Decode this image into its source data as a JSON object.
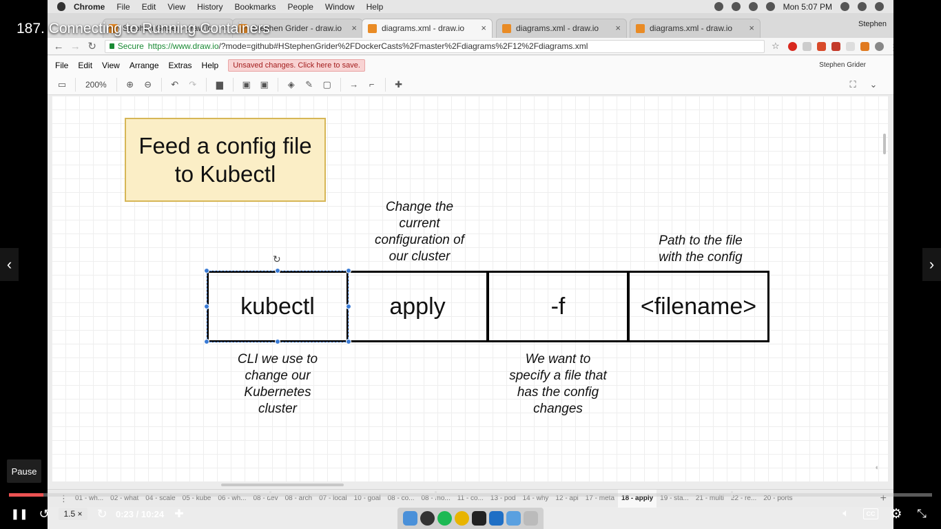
{
  "player": {
    "course_title": "187. Connecting to Running Containers",
    "tooltip": "Pause",
    "speed": "1.5 ×",
    "time": "0:23 / 10:24",
    "progress_fraction": 0.037,
    "accent": "#ec5252"
  },
  "mac_menu": {
    "items": [
      "Chrome",
      "File",
      "Edit",
      "View",
      "History",
      "Bookmarks",
      "People",
      "Window",
      "Help"
    ],
    "clock": "Mon 5:07 PM"
  },
  "browser": {
    "tabs": [
      {
        "title": "Stephen Grider - draw.io",
        "active": false
      },
      {
        "title": "diagrams.xml - draw.io",
        "active": true
      },
      {
        "title": "diagrams.xml - draw.io",
        "active": false
      },
      {
        "title": "diagrams.xml - draw.io",
        "active": false
      }
    ],
    "profile": "Stephen",
    "secure_label": "Secure",
    "url_host": "https://www.draw.io",
    "url_rest": "/?mode=github#HStephenGrider%2FDockerCasts%2Fmaster%2Fdiagrams%2F12%2Fdiagrams.xml"
  },
  "drawio": {
    "menu": [
      "File",
      "Edit",
      "View",
      "Arrange",
      "Extras",
      "Help"
    ],
    "unsaved": "Unsaved changes. Click here to save.",
    "user": "Stephen Grider",
    "zoom": "200%",
    "page_tabs": [
      "01 - wh...",
      "02 - what",
      "04 - scale",
      "05 - kube",
      "06 - wh...",
      "08 - dev",
      "08 - arch",
      "07 - local",
      "10 - goal",
      "08 - co...",
      "08 - mo...",
      "11 - co...",
      "13 - pod",
      "14 - why",
      "12 - api",
      "17 - meta",
      "18 - apply",
      "19 - sta...",
      "21 - multi",
      "22 - re...",
      "20 - ports"
    ],
    "active_page": "18 - apply"
  },
  "diagram": {
    "title": "Feed a config file\nto Kubectl",
    "cells": [
      "kubectl",
      "apply",
      "-f",
      "<filename>"
    ],
    "note_apply": "Change the\ncurrent\nconfiguration of\nour cluster",
    "note_filename": "Path to the file\nwith the config",
    "note_kubectl": "CLI we use to\nchange our\nKubernetes\ncluster",
    "note_f": "We want to\nspecify a file that\nhas the config\nchanges"
  },
  "icons": {
    "prev": "chevron-left-icon",
    "next": "chevron-right-icon"
  }
}
